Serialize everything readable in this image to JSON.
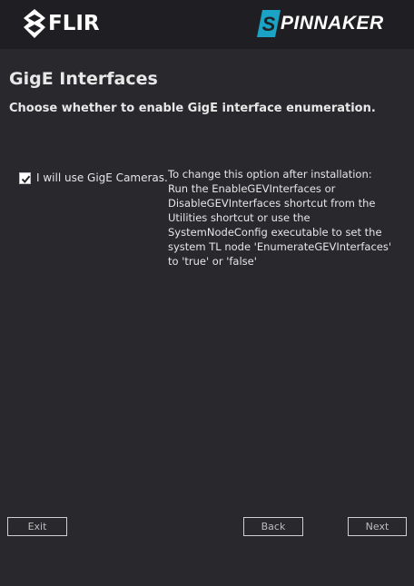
{
  "header": {
    "flir_logo_text": "FLIR",
    "spinnaker_logo_text": "PINNAKER",
    "spinnaker_accent": "#1aa3c4"
  },
  "page": {
    "title": "GigE Interfaces",
    "subtitle": "Choose whether to enable GigE interface enumeration."
  },
  "option": {
    "checkbox_label": "I will use GigE Cameras.",
    "checked": true
  },
  "info": {
    "text": "To change this option after installation:\nRun the EnableGEVInterfaces or DisableGEVInterfaces shortcut from the Utilities shortcut or use the SystemNodeConfig executable to set the system TL node 'EnumerateGEVInterfaces' to 'true' or 'false'"
  },
  "footer": {
    "exit_label": "Exit",
    "back_label": "Back",
    "next_label": "Next"
  }
}
